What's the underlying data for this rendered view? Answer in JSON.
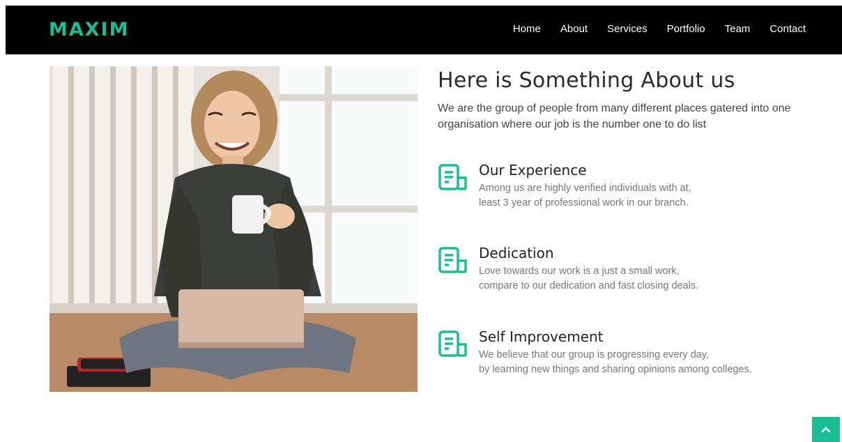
{
  "header": {
    "logo": "MAXIM",
    "nav": [
      "Home",
      "About",
      "Services",
      "Portfolio",
      "Team",
      "Contact"
    ]
  },
  "about": {
    "title": "Here is Something About us",
    "intro": "We are the group of people from many different places gatered into one organisation where our job is the number one to do list",
    "features": [
      {
        "icon": "document-icon",
        "title": "Our Experience",
        "lines": [
          "Among us are highly verified individuals with at,",
          "least 3 year of professional work in our branch."
        ]
      },
      {
        "icon": "document-icon",
        "title": "Dedication",
        "lines": [
          "Love towards our work is a just a small work,",
          "compare to our dedication and fast closing deals."
        ]
      },
      {
        "icon": "document-icon",
        "title": "Self Improvement",
        "lines": [
          "We believe that our group is progressing every day,",
          "by learning new things and sharing opinions among colleges."
        ]
      }
    ]
  },
  "back_to_top": {
    "icon": "chevron-up-icon"
  },
  "colors": {
    "accent": "#1bbd95",
    "nav_bg": "#000000"
  }
}
